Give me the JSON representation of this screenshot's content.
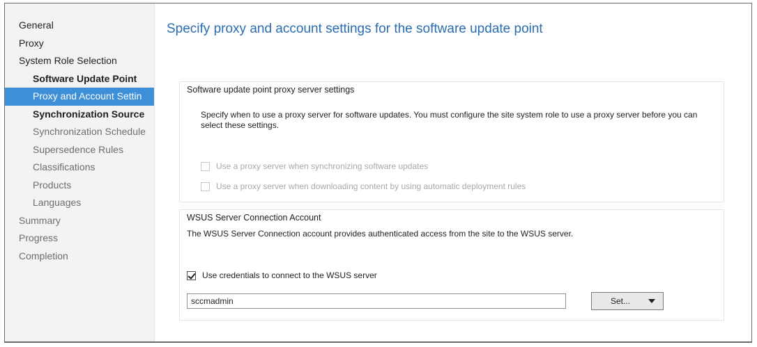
{
  "sidebar": {
    "items": [
      {
        "label": "General"
      },
      {
        "label": "Proxy"
      },
      {
        "label": "System Role Selection"
      },
      {
        "label": "Software Update Point"
      },
      {
        "label": "Proxy and Account Settin"
      },
      {
        "label": "Synchronization Source"
      },
      {
        "label": "Synchronization Schedule"
      },
      {
        "label": "Supersedence Rules"
      },
      {
        "label": "Classifications"
      },
      {
        "label": "Products"
      },
      {
        "label": "Languages"
      },
      {
        "label": "Summary"
      },
      {
        "label": "Progress"
      },
      {
        "label": "Completion"
      }
    ]
  },
  "main": {
    "title": "Specify proxy and account settings for the software update point",
    "proxy_group": {
      "label": "Software update point proxy server settings",
      "description": "Specify when to use a proxy server for software updates. You must configure the site system role to use a proxy server before you can select these settings.",
      "options": [
        {
          "label": "Use a proxy server when synchronizing software updates",
          "checked": false,
          "enabled": false
        },
        {
          "label": "Use a proxy server when downloading content by using automatic deployment rules",
          "checked": false,
          "enabled": false
        }
      ]
    },
    "wsus_group": {
      "label": "WSUS Server Connection Account",
      "description": "The WSUS Server Connection account provides authenticated access from the site to the WSUS server.",
      "use_credentials": {
        "label": "Use credentials to connect to the WSUS server",
        "checked": true
      },
      "account_value": "sccmadmin",
      "set_button_label": "Set..."
    }
  }
}
